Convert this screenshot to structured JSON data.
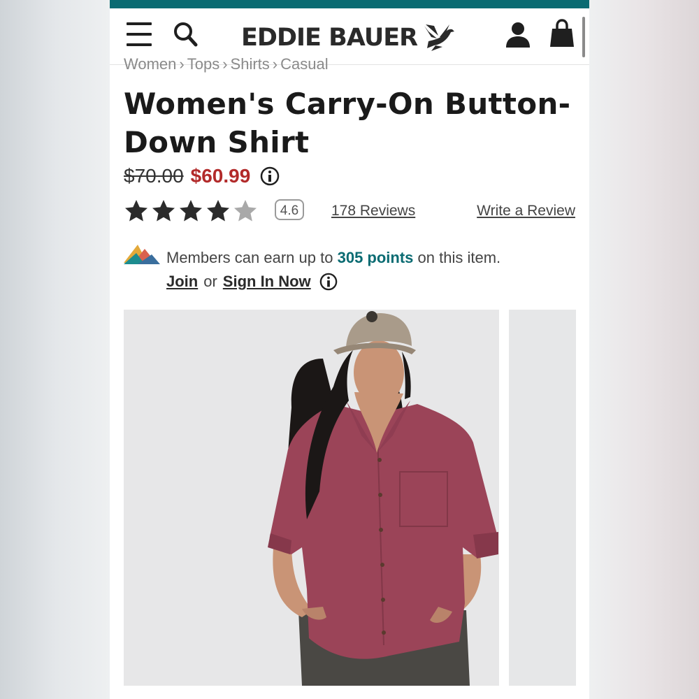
{
  "header": {
    "brand": "EDDIE BAUER",
    "icons": [
      "menu-icon",
      "search-icon",
      "brand-goose-logo",
      "account-icon",
      "shopping-bag-icon"
    ]
  },
  "colors": {
    "accent_teal": "#0a6b72",
    "sale_red": "#b22a2a",
    "star_filled": "#2b2b2b",
    "star_empty": "#a9a9a9",
    "shirt": "#9b4458"
  },
  "breadcrumb": [
    "Women",
    "Tops",
    "Shirts",
    "Casual"
  ],
  "product": {
    "title": "Women's Carry-On Button-Down Shirt",
    "original_price": "$70.00",
    "sale_price": "$60.99",
    "rating": 4.6,
    "rating_label": "4.6",
    "rating_max": 5,
    "reviews_label": "178 Reviews",
    "write_review_label": "Write a Review"
  },
  "rewards": {
    "text_before": "Members can earn up to",
    "points": "305 points",
    "text_after": "on this item.",
    "join_label": "Join",
    "or_label": "or",
    "sign_in_label": "Sign In Now"
  },
  "gallery": {
    "main_image": "model wearing berry button-down shirt, khaki cap",
    "next_image": "next product image (partially visible)"
  }
}
